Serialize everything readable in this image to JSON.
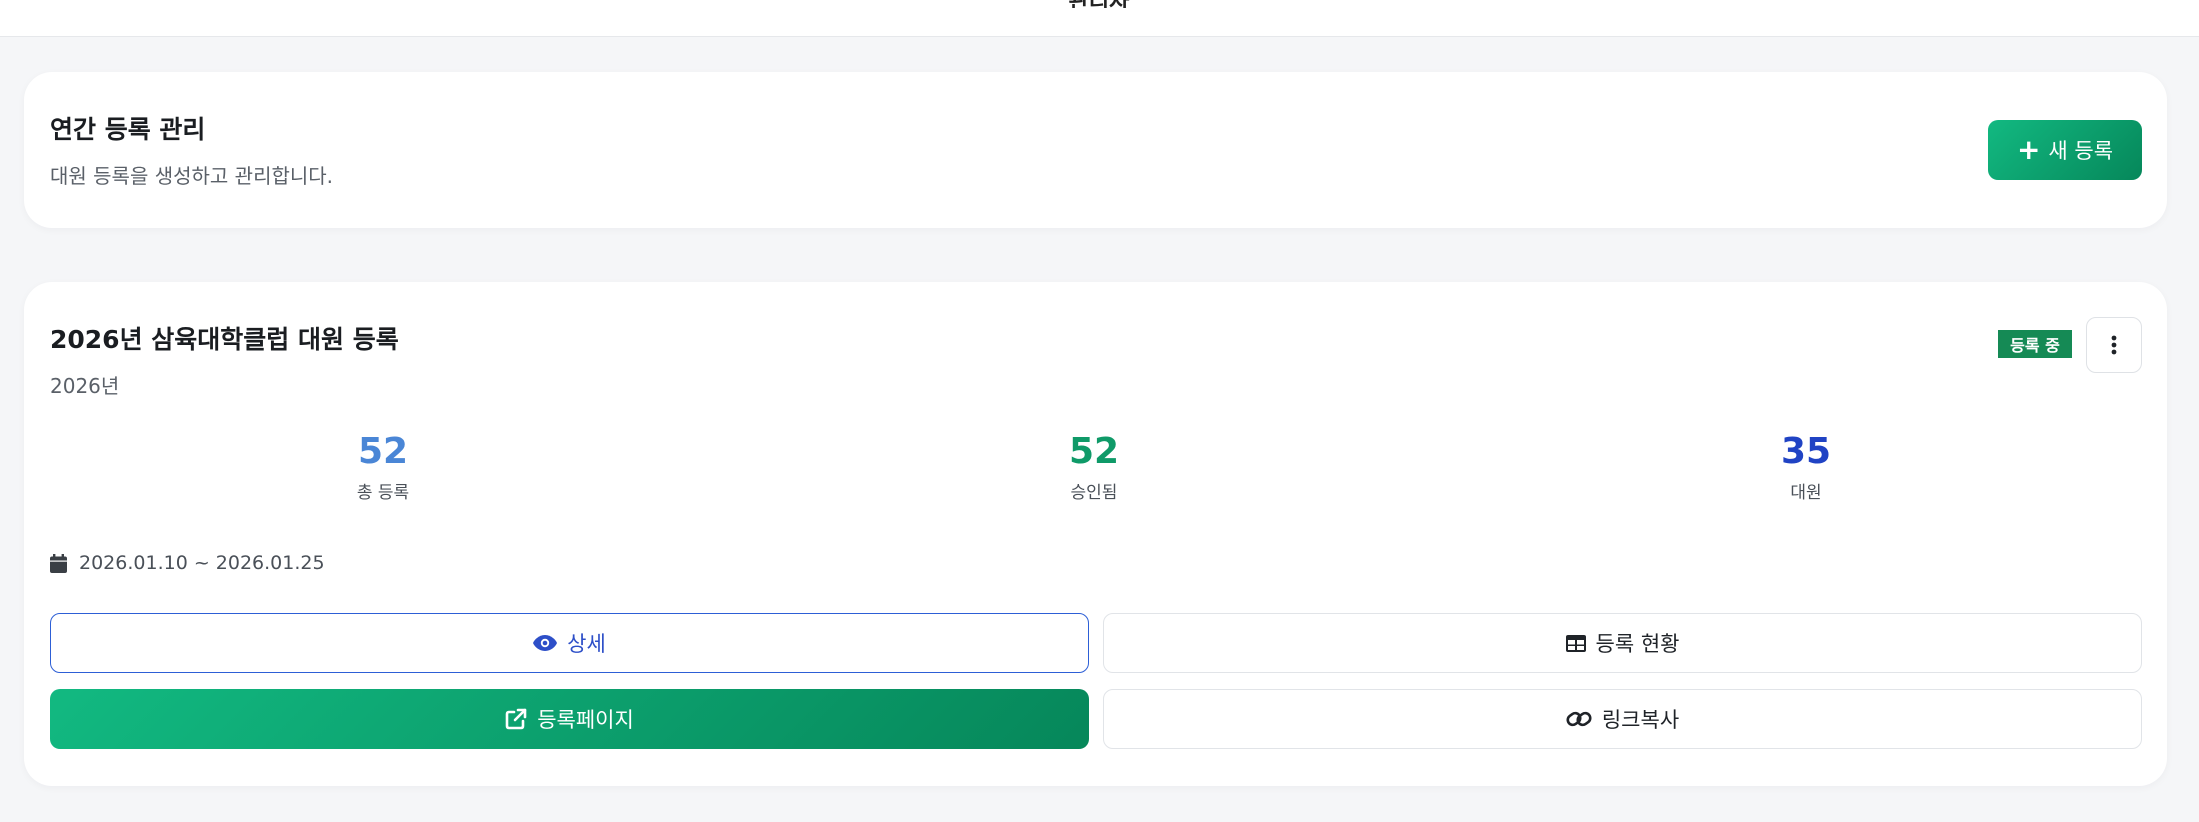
{
  "topbar": {
    "title": "관리자"
  },
  "header_card": {
    "title": "연간 등록 관리",
    "subtitle": "대원 등록을 생성하고 관리합니다.",
    "new_button_label": "새 등록",
    "new_button_icon": "plus-icon"
  },
  "registration": {
    "title": "2026년 삼육대학클럽 대원 등록",
    "year": "2026년",
    "status_badge": "등록 중",
    "colors": {
      "badge": "#158a55",
      "total": "#4a86d6",
      "approved": "#0f9a68",
      "members": "#2043c4",
      "primary": "#10b57e"
    },
    "stats": [
      {
        "value": "52",
        "label": "총 등록"
      },
      {
        "value": "52",
        "label": "승인됨"
      },
      {
        "value": "35",
        "label": "대원"
      }
    ],
    "period": "2026.01.10 ~ 2026.01.25",
    "actions": {
      "detail": "상세",
      "status": "등록 현황",
      "page": "등록페이지",
      "copy_link": "링크복사"
    }
  }
}
